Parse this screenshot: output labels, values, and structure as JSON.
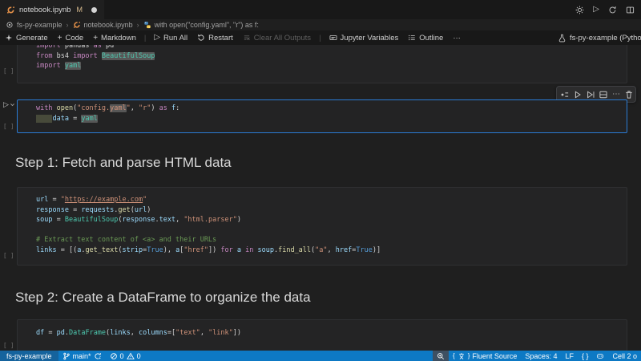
{
  "tab_bar": {
    "tab_title": "notebook.ipynb",
    "git_badge": "M",
    "action_icons": [
      "settings-gear-icon",
      "run-icon",
      "restart-icon",
      "editor-layout-icon"
    ]
  },
  "breadcrumbs": {
    "items": [
      "fs-py-example",
      "notebook.ipynb",
      "with open(\"config.yaml\", \"r\") as f:"
    ]
  },
  "toolbar": {
    "generate": "Generate",
    "add_code": "Code",
    "add_markdown": "Markdown",
    "run_all": "Run All",
    "restart": "Restart",
    "clear_outputs": "Clear All Outputs",
    "jupyter_variables": "Jupyter Variables",
    "outline": "Outline",
    "more": "···",
    "kernel_label": "fs-py-example (Python"
  },
  "notebook": {
    "cells": [
      {
        "kind": "code",
        "exec": "[ ]",
        "lines": [
          [
            {
              "t": "import ",
              "c": "kw"
            },
            {
              "t": "pandas ",
              "c": "def"
            },
            {
              "t": "as ",
              "c": "kw"
            },
            {
              "t": "pd",
              "c": "def"
            }
          ],
          [
            {
              "t": "from ",
              "c": "kw"
            },
            {
              "t": "bs4 ",
              "c": "def"
            },
            {
              "t": "import ",
              "c": "kw"
            },
            {
              "t": "BeautifulSoup",
              "c": "cls",
              "hl": true
            }
          ],
          [
            {
              "t": "import ",
              "c": "kw"
            },
            {
              "t": "yaml",
              "c": "cls",
              "hl": true
            }
          ]
        ]
      },
      {
        "kind": "code",
        "focused": true,
        "exec": "[ ]",
        "run_button": true,
        "lines": [
          [
            {
              "t": "with ",
              "c": "kw"
            },
            {
              "t": "open",
              "c": "fn"
            },
            {
              "t": "(",
              "c": "def"
            },
            {
              "t": "\"config.",
              "c": "str"
            },
            {
              "t": "yaml",
              "c": "str",
              "hl": true
            },
            {
              "t": "\"",
              "c": "str"
            },
            {
              "t": ", ",
              "c": "def"
            },
            {
              "t": "\"r\"",
              "c": "str"
            },
            {
              "t": ")",
              "c": "def"
            },
            {
              "t": " as ",
              "c": "kw"
            },
            {
              "t": "f",
              "c": "var"
            },
            {
              "t": ":",
              "c": "def"
            }
          ],
          [
            {
              "t": "    ",
              "c": "def",
              "ind": true
            },
            {
              "t": "data",
              "c": "var"
            },
            {
              "t": " = ",
              "c": "def"
            },
            {
              "t": "yaml",
              "c": "cls",
              "hl": true
            }
          ]
        ]
      },
      {
        "kind": "markdown",
        "text": "Step 1: Fetch and parse HTML data"
      },
      {
        "kind": "code",
        "exec": "[ ]",
        "lines": [
          [
            {
              "t": "url",
              "c": "var"
            },
            {
              "t": " = ",
              "c": "def"
            },
            {
              "t": "\"",
              "c": "str"
            },
            {
              "t": "https://example.com",
              "c": "str",
              "u": true
            },
            {
              "t": "\"",
              "c": "str"
            }
          ],
          [
            {
              "t": "response",
              "c": "var"
            },
            {
              "t": " = ",
              "c": "def"
            },
            {
              "t": "requests",
              "c": "var"
            },
            {
              "t": ".",
              "c": "def"
            },
            {
              "t": "get",
              "c": "fn"
            },
            {
              "t": "(",
              "c": "def"
            },
            {
              "t": "url",
              "c": "var"
            },
            {
              "t": ")",
              "c": "def"
            }
          ],
          [
            {
              "t": "soup",
              "c": "var"
            },
            {
              "t": " = ",
              "c": "def"
            },
            {
              "t": "BeautifulSoup",
              "c": "cls"
            },
            {
              "t": "(",
              "c": "def"
            },
            {
              "t": "response",
              "c": "var"
            },
            {
              "t": ".",
              "c": "def"
            },
            {
              "t": "text",
              "c": "var"
            },
            {
              "t": ", ",
              "c": "def"
            },
            {
              "t": "\"html.parser\"",
              "c": "str"
            },
            {
              "t": ")",
              "c": "def"
            }
          ],
          [],
          [
            {
              "t": "# Extract text content of <a> and their URLs",
              "c": "com"
            }
          ],
          [
            {
              "t": "links",
              "c": "var"
            },
            {
              "t": " = [(",
              "c": "def"
            },
            {
              "t": "a",
              "c": "var"
            },
            {
              "t": ".",
              "c": "def"
            },
            {
              "t": "get_text",
              "c": "fn"
            },
            {
              "t": "(",
              "c": "def"
            },
            {
              "t": "strip",
              "c": "var"
            },
            {
              "t": "=",
              "c": "def"
            },
            {
              "t": "True",
              "c": "bool"
            },
            {
              "t": "), ",
              "c": "def"
            },
            {
              "t": "a",
              "c": "var"
            },
            {
              "t": "[",
              "c": "def"
            },
            {
              "t": "\"href\"",
              "c": "str"
            },
            {
              "t": "]) ",
              "c": "def"
            },
            {
              "t": "for",
              "c": "kw"
            },
            {
              "t": " a ",
              "c": "var"
            },
            {
              "t": "in",
              "c": "kw"
            },
            {
              "t": " soup",
              "c": "var"
            },
            {
              "t": ".",
              "c": "def"
            },
            {
              "t": "find_all",
              "c": "fn"
            },
            {
              "t": "(",
              "c": "def"
            },
            {
              "t": "\"a\"",
              "c": "str"
            },
            {
              "t": ", ",
              "c": "def"
            },
            {
              "t": "href",
              "c": "var"
            },
            {
              "t": "=",
              "c": "def"
            },
            {
              "t": "True",
              "c": "bool"
            },
            {
              "t": ")]",
              "c": "def"
            }
          ]
        ]
      },
      {
        "kind": "markdown",
        "text": "Step 2: Create a DataFrame to organize the data"
      },
      {
        "kind": "code",
        "exec": "[ ]",
        "lines": [
          [
            {
              "t": "df",
              "c": "var"
            },
            {
              "t": " = ",
              "c": "def"
            },
            {
              "t": "pd",
              "c": "var"
            },
            {
              "t": ".",
              "c": "def"
            },
            {
              "t": "DataFrame",
              "c": "cls"
            },
            {
              "t": "(",
              "c": "def"
            },
            {
              "t": "links",
              "c": "var"
            },
            {
              "t": ", ",
              "c": "def"
            },
            {
              "t": "columns",
              "c": "var"
            },
            {
              "t": "=[",
              "c": "def"
            },
            {
              "t": "\"text\"",
              "c": "str"
            },
            {
              "t": ", ",
              "c": "def"
            },
            {
              "t": "\"link\"",
              "c": "str"
            },
            {
              "t": "])",
              "c": "def"
            }
          ]
        ]
      }
    ],
    "cell_toolbar_icons": [
      "run-by-line-icon",
      "run-above-icon",
      "run-below-icon",
      "split-cell-icon",
      "more-actions-icon",
      "delete-cell-icon"
    ]
  },
  "status_bar": {
    "remote": "fs-py-example",
    "branch": "main*",
    "errors": "0",
    "warnings": "0",
    "ime": "Fluent Source",
    "indent": "Spaces: 4",
    "eol": "LF",
    "brackets": "{ }",
    "cell_indicator": "Cell 2 o"
  },
  "colors": {
    "statusbar": "#0d79c4",
    "focus_border": "#2b7cd5",
    "keyword": "#C586C0",
    "string": "#CE9178",
    "class": "#4EC9B0",
    "variable": "#9CDCFE",
    "comment": "#6A9955",
    "notebook_icon_orange": "#e8934a",
    "python_blue": "#4584b6",
    "python_yellow": "#f2c94c"
  }
}
